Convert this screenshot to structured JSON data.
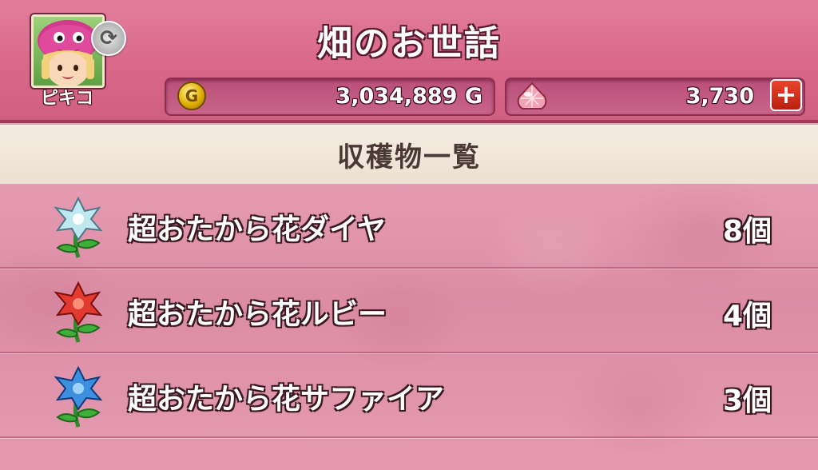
{
  "header": {
    "title": "畑のお世話",
    "avatar": {
      "name": "ピキコ",
      "icon": "character-portrait-icon",
      "swap_icon": "swap-character-icon"
    },
    "gold": {
      "icon": "gold-coin-icon",
      "coin_letter": "G",
      "value": "3,034,889 G"
    },
    "gems": {
      "icon": "gem-icon",
      "value": "3,730",
      "add_button_label": "+"
    }
  },
  "section": {
    "title": "収穫物一覧"
  },
  "items": [
    {
      "name": "超おたから花ダイヤ",
      "count": "8個",
      "icon": "diamond-flower-icon",
      "color": "#bfe9ee"
    },
    {
      "name": "超おたから花ルビー",
      "count": "4個",
      "icon": "ruby-flower-icon",
      "color": "#e23a2e"
    },
    {
      "name": "超おたから花サファイア",
      "count": "3個",
      "icon": "sapphire-flower-icon",
      "color": "#3d8fe0"
    }
  ]
}
